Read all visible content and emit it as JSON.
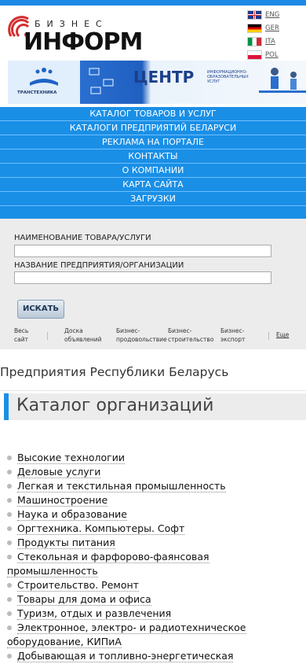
{
  "header": {
    "logo_top": "БИЗНЕС",
    "logo_main": "ИНФОРМ"
  },
  "languages": [
    {
      "code": "ENG",
      "flag": "uk-flag-icon"
    },
    {
      "code": "GER",
      "flag": "germany-flag-icon"
    },
    {
      "code": "ITA",
      "flag": "italy-flag-icon"
    },
    {
      "code": "POL",
      "flag": "poland-flag-icon"
    }
  ],
  "banner": {
    "left_caption": "ТРАНСТЕХНИКА",
    "center_title": "ЦЕНТР",
    "sub_caption": "ИНФОРМАЦИОННО-ОБРАЗОВАТЕЛЬНЫХ УСЛУГ"
  },
  "menu": [
    "КАТАЛОГ ТОВАРОВ И УСЛУГ",
    "КАТАЛОГИ ПРЕДПРИЯТИЙ БЕЛАРУСИ",
    "РЕКЛАМА НА ПОРТАЛЕ",
    "КОНТАКТЫ",
    "О КОМПАНИИ",
    "КАРТА САЙТА",
    "ЗАГРУЗКИ"
  ],
  "search": {
    "product_label": "НАИМЕНОВАНИЕ ТОВАРА/УСЛУГИ",
    "product_value": "",
    "company_label": "НАЗВАНИЕ ПРЕДПРИЯТИЯ/ОРГАНИЗАЦИИ",
    "company_value": "",
    "button_label": "ИСКАТЬ",
    "tabs": [
      {
        "line1": "Весь",
        "line2": "сайт"
      },
      {
        "line1": "Доска",
        "line2": "объявлений"
      },
      {
        "line1": "Бизнес-",
        "line2": "продовольствие"
      },
      {
        "line1": "Бизнес-",
        "line2": "строительство"
      },
      {
        "line1": "Бизнес-",
        "line2": "экспорт"
      }
    ],
    "more_label": "Еще"
  },
  "content": {
    "page_title": "Предприятия Республики Беларусь",
    "catalog_title": "Каталог организаций",
    "categories": [
      "Высокие технологии",
      "Деловые услуги",
      "Легкая и текстильная промышленность",
      "Машиностроение",
      "Наука и образование",
      "Оргтехника. Компьютеры. Софт",
      "Продукты питания",
      "Стекольная и фарфорово-фаянсовая промышленность",
      "Строительство. Ремонт",
      "Товары для дома и офиса",
      "Туризм, отдых и развлечения",
      "Электронное, электро- и радиотехническое оборудование, КИПиА",
      "Добывающая и топливно-энергетическая"
    ]
  },
  "colors": {
    "accent": "#1a8fe6",
    "menu_text": "#ffffff",
    "search_bg": "#ececec"
  }
}
